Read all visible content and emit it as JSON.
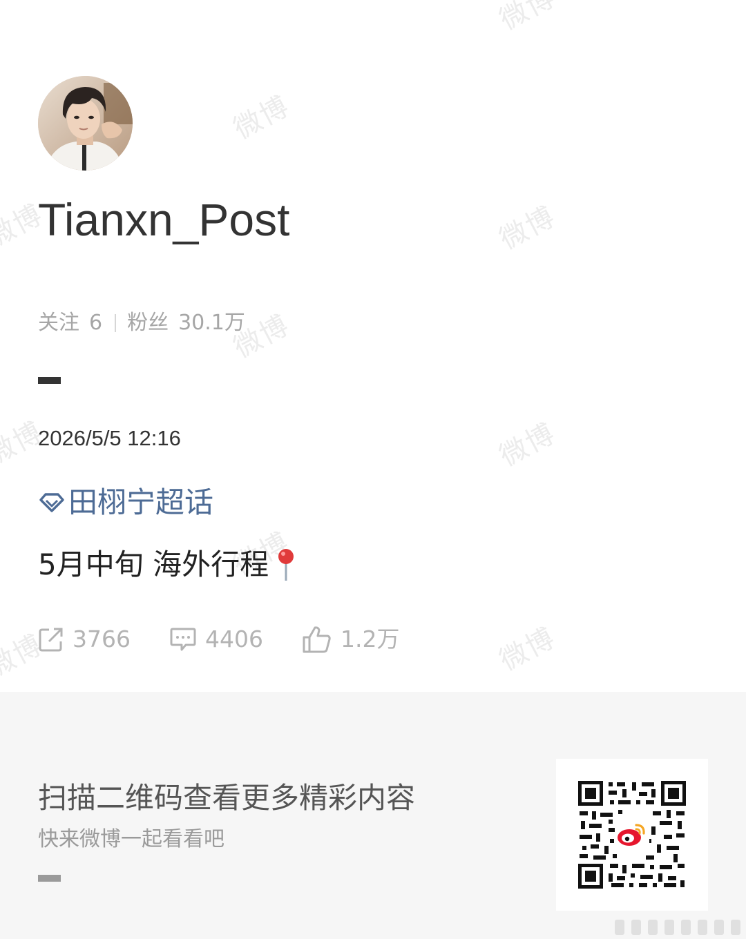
{
  "watermark": {
    "text": "微博"
  },
  "profile": {
    "username": "Tianxn_Post",
    "following_label": "关注",
    "following_count": "6",
    "followers_label": "粉丝",
    "followers_count": "30.1万"
  },
  "post": {
    "timestamp": "2026/5/5 12:16",
    "topic": "田栩宁超话",
    "text": "5月中旬 海外行程",
    "pin_icon": "location-pin-icon"
  },
  "actions": {
    "repost_count": "3766",
    "comment_count": "4406",
    "like_count": "1.2万"
  },
  "footer": {
    "title": "扫描二维码查看更多精彩内容",
    "subtitle": "快来微博一起看看吧"
  },
  "colors": {
    "topic": "#4d6b95",
    "text": "#333333",
    "muted": "#a6a6a6",
    "footer_bg": "#f6f6f6",
    "weibo_red": "#e6162d"
  }
}
